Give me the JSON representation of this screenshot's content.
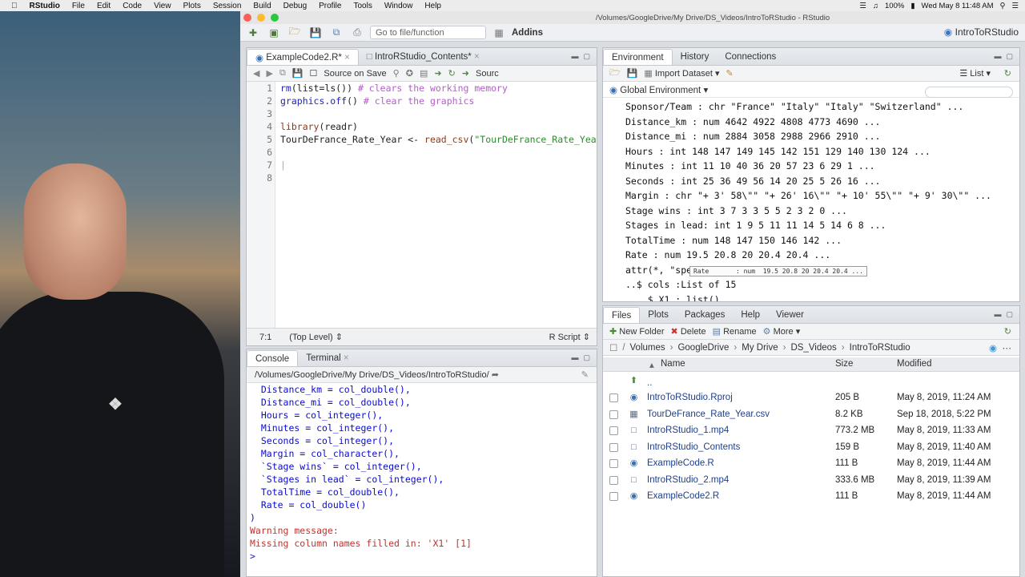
{
  "menubar": {
    "app": "RStudio",
    "items": [
      "File",
      "Edit",
      "Code",
      "View",
      "Plots",
      "Session",
      "Build",
      "Debug",
      "Profile",
      "Tools",
      "Window",
      "Help"
    ],
    "battery": "100%",
    "clock": "Wed May 8  11:48 AM"
  },
  "window": {
    "title": "/Volumes/GoogleDrive/My Drive/DS_Videos/IntroToRStudio - RStudio",
    "goto_placeholder": "Go to file/function",
    "addins": "Addins",
    "project": "IntroToRStudio"
  },
  "editor": {
    "tabs": [
      "ExampleCode2.R*",
      "IntroRStudio_Contents*"
    ],
    "source_on_save": "Source on Save",
    "source": "Sourc",
    "lines": [
      {
        "n": "1",
        "t": "rm(list=ls()) # clears the working memory"
      },
      {
        "n": "2",
        "t": "graphics.off() # clear the graphics"
      },
      {
        "n": "3",
        "t": ""
      },
      {
        "n": "4",
        "t": "library(readr)"
      },
      {
        "n": "5",
        "t": "TourDeFrance_Rate_Year <- read_csv(\"TourDeFrance_Rate_Year"
      },
      {
        "n": "6",
        "t": ""
      },
      {
        "n": "7",
        "t": ""
      },
      {
        "n": "8",
        "t": ""
      }
    ],
    "status_pos": "7:1",
    "status_scope": "(Top Level)",
    "status_type": "R Script"
  },
  "console": {
    "tabs": [
      "Console",
      "Terminal"
    ],
    "path": "/Volumes/GoogleDrive/My Drive/DS_Videos/IntroToRStudio/",
    "lines": [
      "  Distance_km = col_double(),",
      "  Distance_mi = col_double(),",
      "  Hours = col_integer(),",
      "  Minutes = col_integer(),",
      "  Seconds = col_integer(),",
      "  Margin = col_character(),",
      "  `Stage wins` = col_integer(),",
      "  `Stages in lead` = col_integer(),",
      "  TotalTime = col_double(),",
      "  Rate = col_double()",
      ")"
    ],
    "warn1": "Warning message:",
    "warn2": "Missing column names filled in: 'X1' [1]",
    "prompt": ">"
  },
  "environment": {
    "tabs": [
      "Environment",
      "History",
      "Connections"
    ],
    "import": "Import Dataset",
    "view_mode": "List",
    "scope": "Global Environment",
    "rows": [
      "Sponsor/Team : chr \"France\" \"Italy\" \"Italy\" \"Switzerland\" ...",
      "Distance_km : num 4642 4922 4808 4773 4690 ...",
      "Distance_mi : num 2884 3058 2988 2966 2910 ...",
      "Hours : int 148 147 149 145 142 151 129 140 130 124 ...",
      "Minutes : int 11 10 40 36 20 57 23 6 29 1 ...",
      "Seconds : int 25 36 49 56 14 20 25 5 26 16 ...",
      "Margin : chr \"+ 3' 58\\\"\" \"+ 26' 16\\\"\" \"+ 10' 55\\\"\" \"+ 9' 30\\\"\" ...",
      "Stage wins : int 3 7 3 3 5 5 2 3 2 0 ...",
      "Stages in lead: int 1 9 5 11 11 14 5 14 6 8 ...",
      "TotalTime : num 148 147 150 146 142 ...",
      "Rate : num 19.5 20.8 20 20.4 20.4 ...",
      "attr(*, \"spe",
      "..$ cols :List of 15",
      "    $ X1 : list()"
    ],
    "tooltip": "Rate       : num  19.5 20.8 20 20.4 20.4 ..."
  },
  "files": {
    "tabs": [
      "Files",
      "Plots",
      "Packages",
      "Help",
      "Viewer"
    ],
    "new_folder": "New Folder",
    "delete": "Delete",
    "rename": "Rename",
    "more": "More",
    "crumbs": [
      "Volumes",
      "GoogleDrive",
      "My Drive",
      "DS_Videos",
      "IntroToRStudio"
    ],
    "col_name": "Name",
    "col_size": "Size",
    "col_modified": "Modified",
    "up": "..",
    "rows": [
      {
        "name": "IntroToRStudio.Rproj",
        "size": "205 B",
        "modified": "May 8, 2019, 11:24 AM"
      },
      {
        "name": "TourDeFrance_Rate_Year.csv",
        "size": "8.2 KB",
        "modified": "Sep 18, 2018, 5:22 PM"
      },
      {
        "name": "IntroRStudio_1.mp4",
        "size": "773.2 MB",
        "modified": "May 8, 2019, 11:33 AM"
      },
      {
        "name": "IntroRStudio_Contents",
        "size": "159 B",
        "modified": "May 8, 2019, 11:40 AM"
      },
      {
        "name": "ExampleCode.R",
        "size": "111 B",
        "modified": "May 8, 2019, 11:44 AM"
      },
      {
        "name": "IntroRStudio_2.mp4",
        "size": "333.6 MB",
        "modified": "May 8, 2019, 11:39 AM"
      },
      {
        "name": "ExampleCode2.R",
        "size": "111 B",
        "modified": "May 8, 2019, 11:44 AM"
      }
    ]
  }
}
